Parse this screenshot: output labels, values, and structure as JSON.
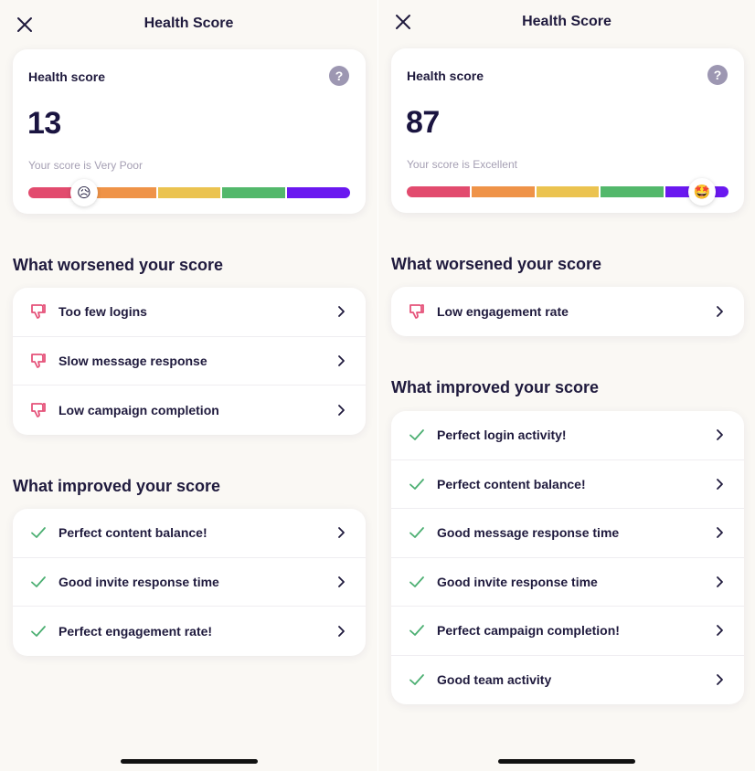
{
  "screens": [
    {
      "header": {
        "title": "Health Score"
      },
      "score_card": {
        "label": "Health score",
        "help": "?",
        "value": "13",
        "status_text": "Your score is Very Poor",
        "marker_emoji": "😥",
        "bar_colors": [
          "#e24b6e",
          "#ef9348",
          "#ebc350",
          "#53b86b",
          "#6a18f0"
        ]
      },
      "worsened": {
        "title": "What worsened your score",
        "items": [
          {
            "label": "Too few logins",
            "icon": "thumbs-down-icon"
          },
          {
            "label": "Slow message response",
            "icon": "thumbs-down-icon"
          },
          {
            "label": "Low campaign completion",
            "icon": "thumbs-down-icon"
          }
        ]
      },
      "improved": {
        "title": "What improved your score",
        "items": [
          {
            "label": "Perfect content balance!",
            "icon": "check-icon"
          },
          {
            "label": "Good invite response time",
            "icon": "check-icon"
          },
          {
            "label": "Perfect engagement rate!",
            "icon": "check-icon"
          }
        ]
      }
    },
    {
      "header": {
        "title": "Health Score"
      },
      "score_card": {
        "label": "Health score",
        "help": "?",
        "value": "87",
        "status_text": "Your score is Excellent",
        "marker_emoji": "🤩",
        "bar_colors": [
          "#e24b6e",
          "#ef9348",
          "#ebc350",
          "#53b86b",
          "#6a18f0"
        ]
      },
      "worsened": {
        "title": "What worsened your score",
        "items": [
          {
            "label": "Low engagement rate",
            "icon": "thumbs-down-icon"
          }
        ]
      },
      "improved": {
        "title": "What improved your score",
        "items": [
          {
            "label": "Perfect login activity!",
            "icon": "check-icon"
          },
          {
            "label": "Perfect content balance!",
            "icon": "check-icon"
          },
          {
            "label": "Good message response time",
            "icon": "check-icon"
          },
          {
            "label": "Good invite response time",
            "icon": "check-icon"
          },
          {
            "label": "Perfect campaign completion!",
            "icon": "check-icon"
          },
          {
            "label": "Good team activity",
            "icon": "check-icon"
          }
        ]
      }
    }
  ],
  "colors": {
    "accent_negative": "#e5537a",
    "accent_positive": "#4caf72",
    "text": "#1f1a3d",
    "muted": "#a59fb3"
  }
}
